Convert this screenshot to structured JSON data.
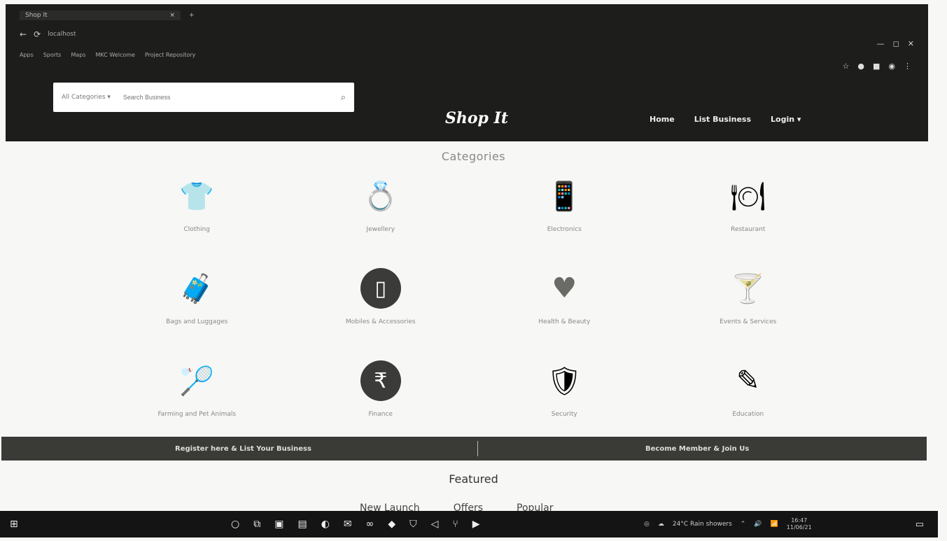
{
  "browser": {
    "tab_title": "Shop It",
    "tab_close": "×",
    "new_tab": "+",
    "address": "localhost",
    "bookmarks": [
      "Apps",
      "Sports",
      "Maps",
      "MKC Welcome",
      "Project Repository"
    ],
    "window_controls": [
      "—",
      "◻",
      "✕"
    ]
  },
  "header": {
    "search_category": "All Categories ▾",
    "search_placeholder": "Search Business",
    "brand": "Shop It",
    "nav": {
      "home": "Home",
      "list_business": "List Business",
      "login": "Login ▾"
    }
  },
  "categories": {
    "title": "Categories",
    "items": [
      {
        "label": "Clothing",
        "icon": "shirt-icon",
        "glyph": "👕"
      },
      {
        "label": "Jewellery",
        "icon": "jewellery-icon",
        "glyph": "💍"
      },
      {
        "label": "Electronics",
        "icon": "electronics-icon",
        "glyph": "📱"
      },
      {
        "label": "Restaurant",
        "icon": "restaurant-icon",
        "glyph": "🍽"
      },
      {
        "label": "Bags and Luggages",
        "icon": "bags-icon",
        "glyph": "🧳"
      },
      {
        "label": "Mobiles & Accessories",
        "icon": "mobile-icon",
        "glyph": "▯"
      },
      {
        "label": "Health & Beauty",
        "icon": "heart-icon",
        "glyph": "♥"
      },
      {
        "label": "Events & Services",
        "icon": "events-icon",
        "glyph": "🍸"
      },
      {
        "label": "Farming and Pet Animals",
        "icon": "racket-icon",
        "glyph": "🏸"
      },
      {
        "label": "Finance",
        "icon": "rupee-icon",
        "glyph": "₹"
      },
      {
        "label": "Security",
        "icon": "security-shield-icon",
        "glyph": "🛡"
      },
      {
        "label": "Education",
        "icon": "education-icon",
        "glyph": "✎"
      }
    ]
  },
  "promo": {
    "left": "Register here & List Your Business",
    "right": "Become Member & Join Us"
  },
  "featured": {
    "title": "Featured",
    "tabs": [
      "New Launch",
      "Offers",
      "Popular"
    ]
  },
  "taskbar": {
    "weather": "24°C Rain showers",
    "time": "16:47",
    "date": "11/06/21"
  }
}
